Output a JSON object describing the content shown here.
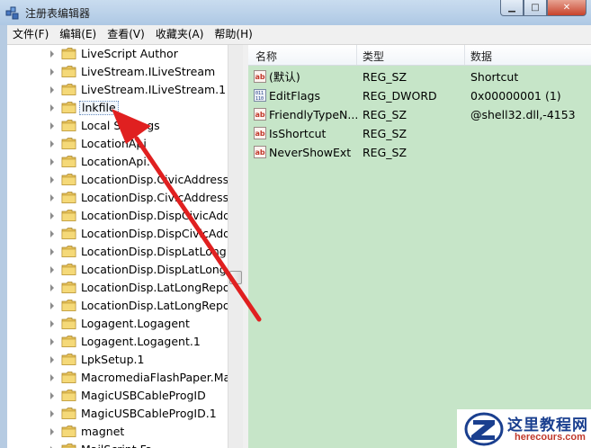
{
  "window": {
    "title": "注册表编辑器",
    "min_label": "▁",
    "max_label": "□",
    "close_label": "✕"
  },
  "menu": [
    "文件(F)",
    "编辑(E)",
    "查看(V)",
    "收藏夹(A)",
    "帮助(H)"
  ],
  "tree": {
    "selected_index": 3,
    "items": [
      "LiveScript Author",
      "LiveStream.ILiveStream",
      "LiveStream.ILiveStream.1",
      "lnkfile",
      "Local Settings",
      "LocationApi",
      "LocationApi.",
      "LocationDisp.CivicAddressRe",
      "LocationDisp.CivicAddressRe",
      "LocationDisp.DispCivicAddre",
      "LocationDisp.DispCivicAddre",
      "LocationDisp.DispLatLongRe",
      "LocationDisp.DispLatLongRe",
      "LocationDisp.LatLongReport",
      "LocationDisp.LatLongReport",
      "Logagent.Logagent",
      "Logagent.Logagent.1",
      "LpkSetup.1",
      "MacromediaFlashPaper.Mac",
      "MagicUSBCableProgID",
      "MagicUSBCableProgID.1",
      "magnet",
      "MailScript.Fa..."
    ]
  },
  "values": {
    "headers": {
      "name": "名称",
      "type": "类型",
      "data": "数据"
    },
    "rows": [
      {
        "icon": "string-value-icon",
        "name": "(默认)",
        "type": "REG_SZ",
        "data": "Shortcut"
      },
      {
        "icon": "binary-value-icon",
        "name": "EditFlags",
        "type": "REG_DWORD",
        "data": "0x00000001 (1)"
      },
      {
        "icon": "string-value-icon",
        "name": "FriendlyTypeN...",
        "type": "REG_SZ",
        "data": "@shell32.dll,-4153"
      },
      {
        "icon": "string-value-icon",
        "name": "IsShortcut",
        "type": "REG_SZ",
        "data": ""
      },
      {
        "icon": "string-value-icon",
        "name": "NeverShowExt",
        "type": "REG_SZ",
        "data": ""
      }
    ]
  },
  "watermark": {
    "title": "这里教程网",
    "url": "herecours.com"
  },
  "colors": {
    "values_bg": "#c6e5c8",
    "arrow": "#e02020"
  }
}
